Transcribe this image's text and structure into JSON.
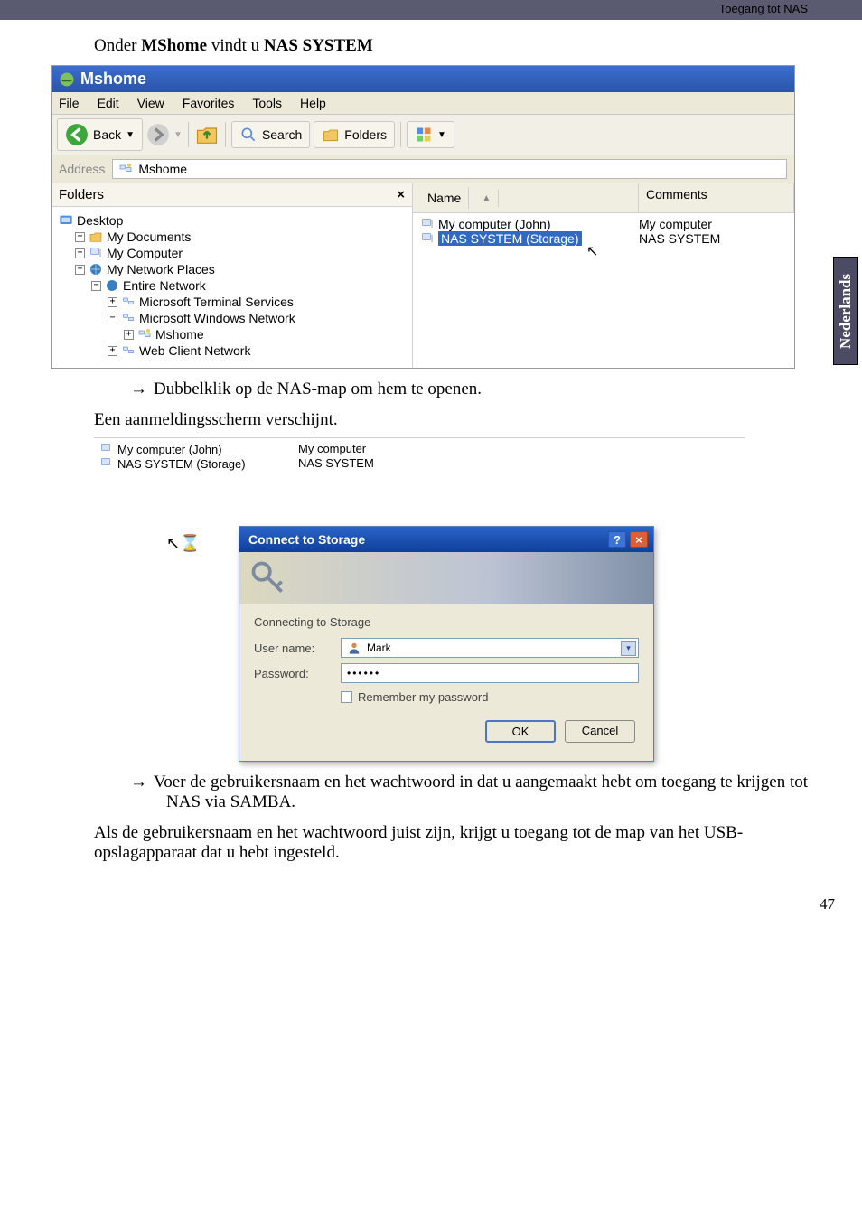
{
  "topbar": {
    "breadcrumb": "Toegang tot NAS"
  },
  "side_tab": "Nederlands",
  "heading": {
    "pre": "Onder ",
    "bold1": "MShome",
    "mid": " vindt u ",
    "bold2": "NAS SYSTEM"
  },
  "explorer": {
    "title": "Mshome",
    "menu": [
      "File",
      "Edit",
      "View",
      "Favorites",
      "Tools",
      "Help"
    ],
    "toolbar": {
      "back": "Back",
      "search": "Search",
      "folders": "Folders"
    },
    "address_label": "Address",
    "address_value": "Mshome",
    "folders_header": "Folders",
    "tree": {
      "desktop": "Desktop",
      "mydocs": "My Documents",
      "mycomputer": "My Computer",
      "netplaces": "My Network Places",
      "entirenet": "Entire Network",
      "msterm": "Microsoft Terminal Services",
      "mswin": "Microsoft Windows Network",
      "mshome": "Mshome",
      "webclient": "Web Client Network"
    },
    "columns": {
      "name": "Name",
      "comments": "Comments"
    },
    "rows": [
      {
        "name": "My computer (John)",
        "comment": "My computer"
      },
      {
        "name": "NAS SYSTEM (Storage)",
        "comment": "NAS SYSTEM"
      }
    ]
  },
  "instr1": "Dubbelklik op de NAS-map om hem te openen.",
  "para1": "Een aanmeldingsscherm verschijnt.",
  "shot2_rows": [
    {
      "name": "My computer (John)",
      "comment": "My computer"
    },
    {
      "name": "NAS SYSTEM (Storage)",
      "comment": "NAS SYSTEM"
    }
  ],
  "dialog": {
    "title": "Connect to Storage",
    "connecting": "Connecting to Storage",
    "user_label": "User name:",
    "user_value": "Mark",
    "pw_label": "Password:",
    "pw_mask": "••••••",
    "remember": "Remember my password",
    "ok": "OK",
    "cancel": "Cancel"
  },
  "instr2": "Voer de gebruikersnaam en het wachtwoord in dat u aangemaakt hebt om toegang te krijgen tot NAS via SAMBA.",
  "para2": "Als de gebruikersnaam en het wachtwoord juist zijn, krijgt u toegang tot de map van het USB-opslagapparaat dat u hebt ingesteld.",
  "page_number": "47"
}
